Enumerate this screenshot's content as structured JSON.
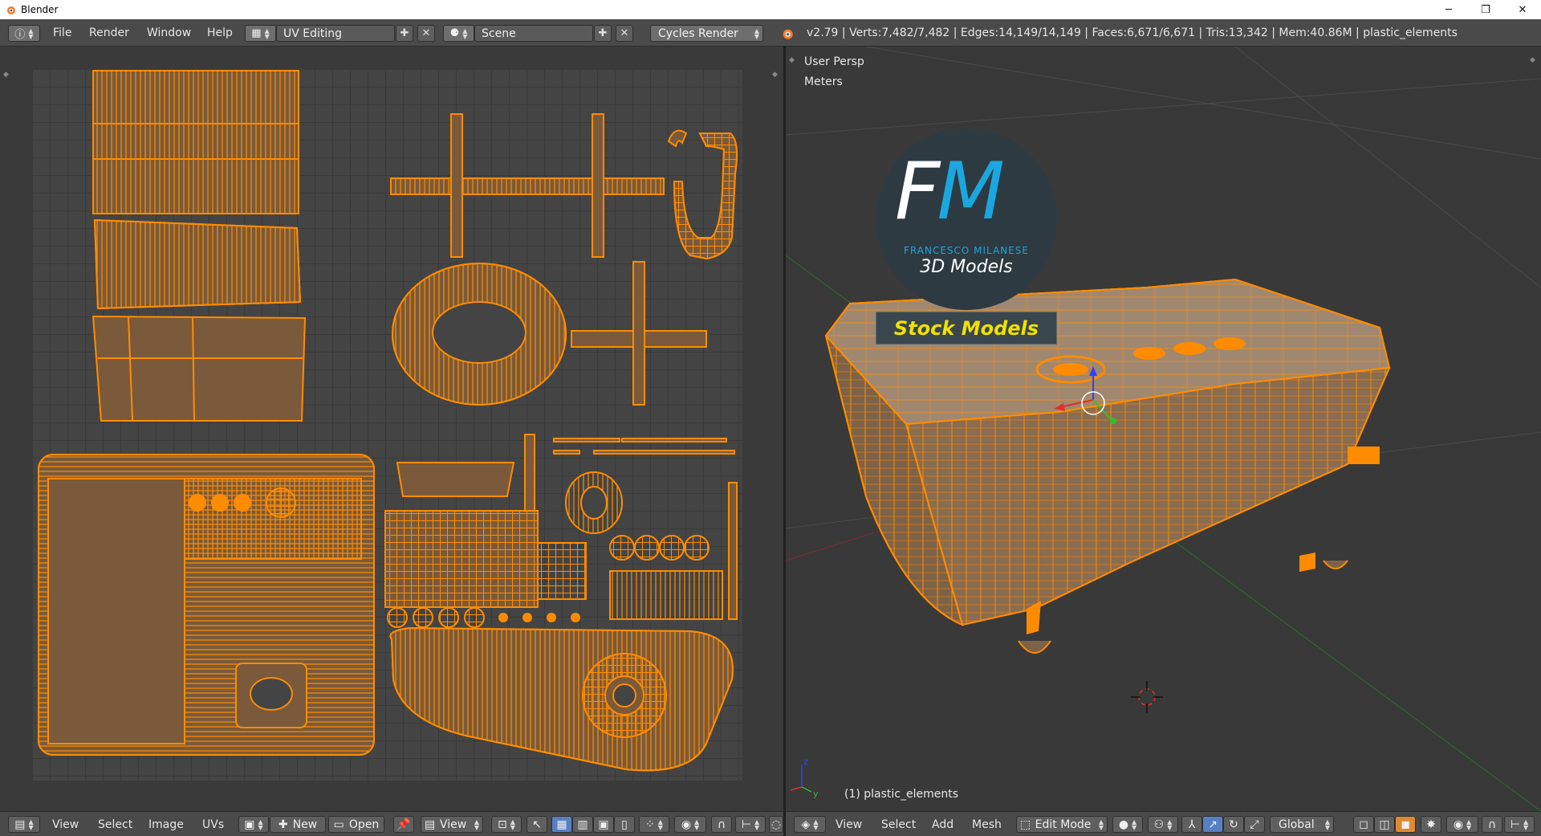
{
  "window": {
    "title": "Blender",
    "minimize": "─",
    "maximize": "❐",
    "close": "✕"
  },
  "info_header": {
    "menus": [
      "File",
      "Render",
      "Window",
      "Help"
    ],
    "screen_layout": "UV Editing",
    "scene": "Scene",
    "render_engine": "Cycles Render",
    "stats": "v2.79 | Verts:7,482/7,482 | Edges:14,149/14,149 | Faces:6,671/6,671 | Tris:13,342 | Mem:40.86M | plastic_elements"
  },
  "viewport": {
    "view_name": "User Persp",
    "units": "Meters",
    "object_label": "(1) plastic_elements"
  },
  "logo": {
    "initial_f": "F",
    "initial_m": "M",
    "author": "FRANCESCO MILANESE",
    "subtitle": "3D Models",
    "banner": "Stock Models"
  },
  "uv_header": {
    "menus": [
      "View",
      "Select",
      "Image",
      "UVs"
    ],
    "new_label": "New",
    "open_label": "Open",
    "view_label": "View"
  },
  "view3d_header": {
    "menus": [
      "View",
      "Select",
      "Add",
      "Mesh"
    ],
    "mode": "Edit Mode",
    "orientation": "Global"
  },
  "colors": {
    "uv_orange": "#ff8c00",
    "uv_fill": "#7a5a3a",
    "header_bg": "#4a4a4a",
    "viewport_bg": "#393939",
    "logo_blue": "#1aa7e0",
    "logo_yellow": "#f0e100"
  }
}
